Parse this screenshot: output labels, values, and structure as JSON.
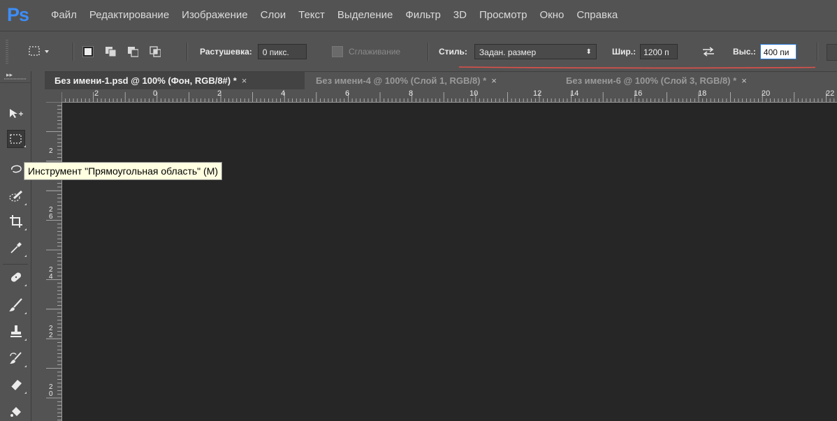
{
  "app": {
    "logo": "Ps"
  },
  "menu": [
    "Файл",
    "Редактирование",
    "Изображение",
    "Слои",
    "Текст",
    "Выделение",
    "Фильтр",
    "3D",
    "Просмотр",
    "Окно",
    "Справка"
  ],
  "options": {
    "feather_label": "Растушевка:",
    "feather_value": "0 пикс.",
    "antialias_label": "Сглаживание",
    "style_label": "Стиль:",
    "style_value": "Задан. размер",
    "width_label": "Шир.:",
    "width_value": "1200 п",
    "height_label": "Выс.:",
    "height_value": "400 пи"
  },
  "tabs": [
    {
      "label": "Без имени-1.psd @ 100% (Фон, RGB/8#) *",
      "active": true
    },
    {
      "label": "Без имени-4 @ 100% (Слой 1, RGB/8) *",
      "active": false
    },
    {
      "label": "Без имени-6 @ 100% (Слой 3, RGB/8) *",
      "active": false
    }
  ],
  "tab_close": "×",
  "ruler_h": [
    "2",
    "0",
    "2",
    "4",
    "6",
    "8",
    "10",
    "12",
    "14",
    "16",
    "18",
    "20",
    "22"
  ],
  "ruler_v": [
    "2",
    "2\n6",
    "2\n4",
    "2\n2",
    "2\n0"
  ],
  "tooltip": "Инструмент \"Прямоугольная область\" (M)",
  "colors": {
    "accent": "#3d8df7",
    "canvas": "#262626",
    "ui": "#535353",
    "tooltip_bg": "#ffffe1",
    "highlight": "#e0504a"
  }
}
